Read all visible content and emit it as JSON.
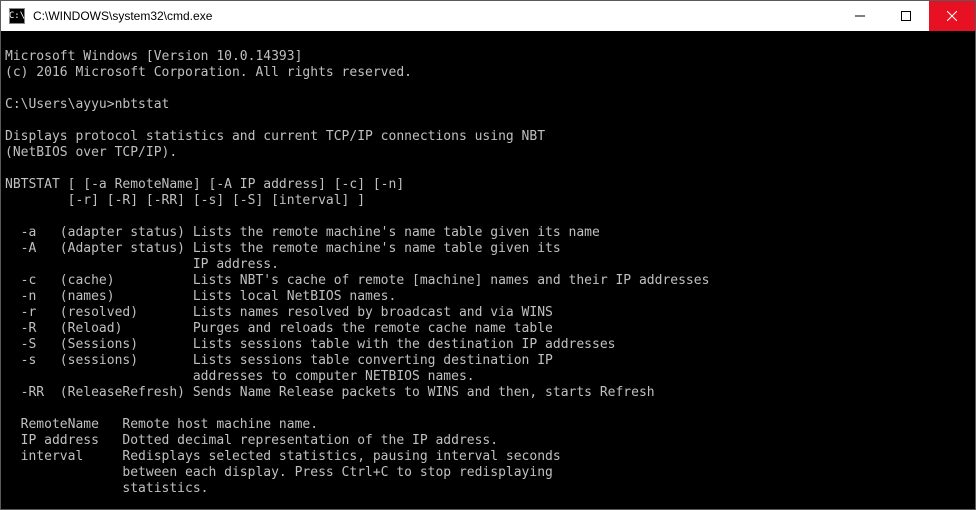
{
  "window": {
    "title": "C:\\WINDOWS\\system32\\cmd.exe",
    "icon_label": "C:\\"
  },
  "terminal": {
    "banner_line1": "Microsoft Windows [Version 10.0.14393]",
    "banner_line2": "(c) 2016 Microsoft Corporation. All rights reserved.",
    "prompt": "C:\\Users\\ayyu>nbtstat",
    "desc_line1": "Displays protocol statistics and current TCP/IP connections using NBT",
    "desc_line2": "(NetBIOS over TCP/IP).",
    "usage_line1": "NBTSTAT [ [-a RemoteName] [-A IP address] [-c] [-n]",
    "usage_line2": "        [-r] [-R] [-RR] [-s] [-S] [interval] ]",
    "opt_a": "  -a   (adapter status) Lists the remote machine's name table given its name",
    "opt_A1": "  -A   (Adapter status) Lists the remote machine's name table given its",
    "opt_A2": "                        IP address.",
    "opt_c": "  -c   (cache)          Lists NBT's cache of remote [machine] names and their IP addresses",
    "opt_n": "  -n   (names)          Lists local NetBIOS names.",
    "opt_r": "  -r   (resolved)       Lists names resolved by broadcast and via WINS",
    "opt_R": "  -R   (Reload)         Purges and reloads the remote cache name table",
    "opt_S": "  -S   (Sessions)       Lists sessions table with the destination IP addresses",
    "opt_s1": "  -s   (sessions)       Lists sessions table converting destination IP",
    "opt_s2": "                        addresses to computer NETBIOS names.",
    "opt_RR": "  -RR  (ReleaseRefresh) Sends Name Release packets to WINS and then, starts Refresh",
    "arg_remote": "  RemoteName   Remote host machine name.",
    "arg_ip": "  IP address   Dotted decimal representation of the IP address.",
    "arg_interval1": "  interval     Redisplays selected statistics, pausing interval seconds",
    "arg_interval2": "               between each display. Press Ctrl+C to stop redisplaying",
    "arg_interval3": "               statistics."
  }
}
